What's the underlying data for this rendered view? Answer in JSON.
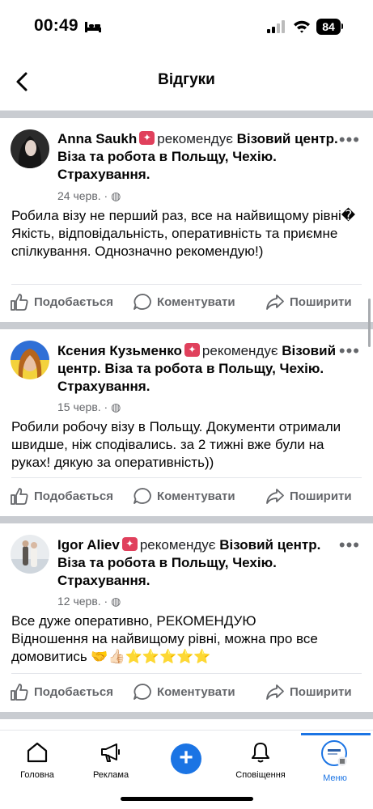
{
  "status": {
    "time": "00:49",
    "battery": "84"
  },
  "header": {
    "title": "Відгуки"
  },
  "reviews": [
    {
      "author": "Anna Saukh",
      "verb": "рекомендує",
      "page": "Візовий центр. Віза та робота в Польщу, Чехію. Страхування.",
      "date": "24 черв.",
      "text": "Робила візу не перший раз, все на найвищому рівні�\nЯкість, відповідальність, оперативність та приємне спілкування. Однозначно рекомендую!)"
    },
    {
      "author": "Ксения Кузьменко",
      "verb": "рекомендує",
      "page": "Візовий центр. Віза та робота в Польщу, Чехію. Страхування.",
      "date": "15 черв.",
      "text": "Робили робочу візу в Польщу. Документи отримали швидше, ніж сподівались. за 2 тижні вже були на руках! дякую за оперативність))"
    },
    {
      "author": "Igor Aliev",
      "verb": "рекомендує",
      "page": "Візовий центр. Віза та робота в Польщу, Чехію. Страхування.",
      "date": "12 черв.",
      "text": "Все дуже оперативно, РЕКОМЕНДУЮ\nВідношення на найвищому рівні, можна про все домовитись 🤝👍🏻⭐⭐⭐⭐⭐"
    }
  ],
  "actions": {
    "like": "Подобається",
    "comment": "Коментувати",
    "share": "Поширити"
  },
  "tabs": [
    {
      "label": "Головна",
      "icon": "home-icon"
    },
    {
      "label": "Реклама",
      "icon": "megaphone-icon"
    },
    {
      "label": "",
      "icon": "plus-icon"
    },
    {
      "label": "Сповіщення",
      "icon": "bell-icon"
    },
    {
      "label": "Меню",
      "icon": "profile-avatar-icon"
    }
  ],
  "colors": {
    "accent": "#1b74e4",
    "verified": "#e0405c",
    "muted": "#65676b"
  }
}
